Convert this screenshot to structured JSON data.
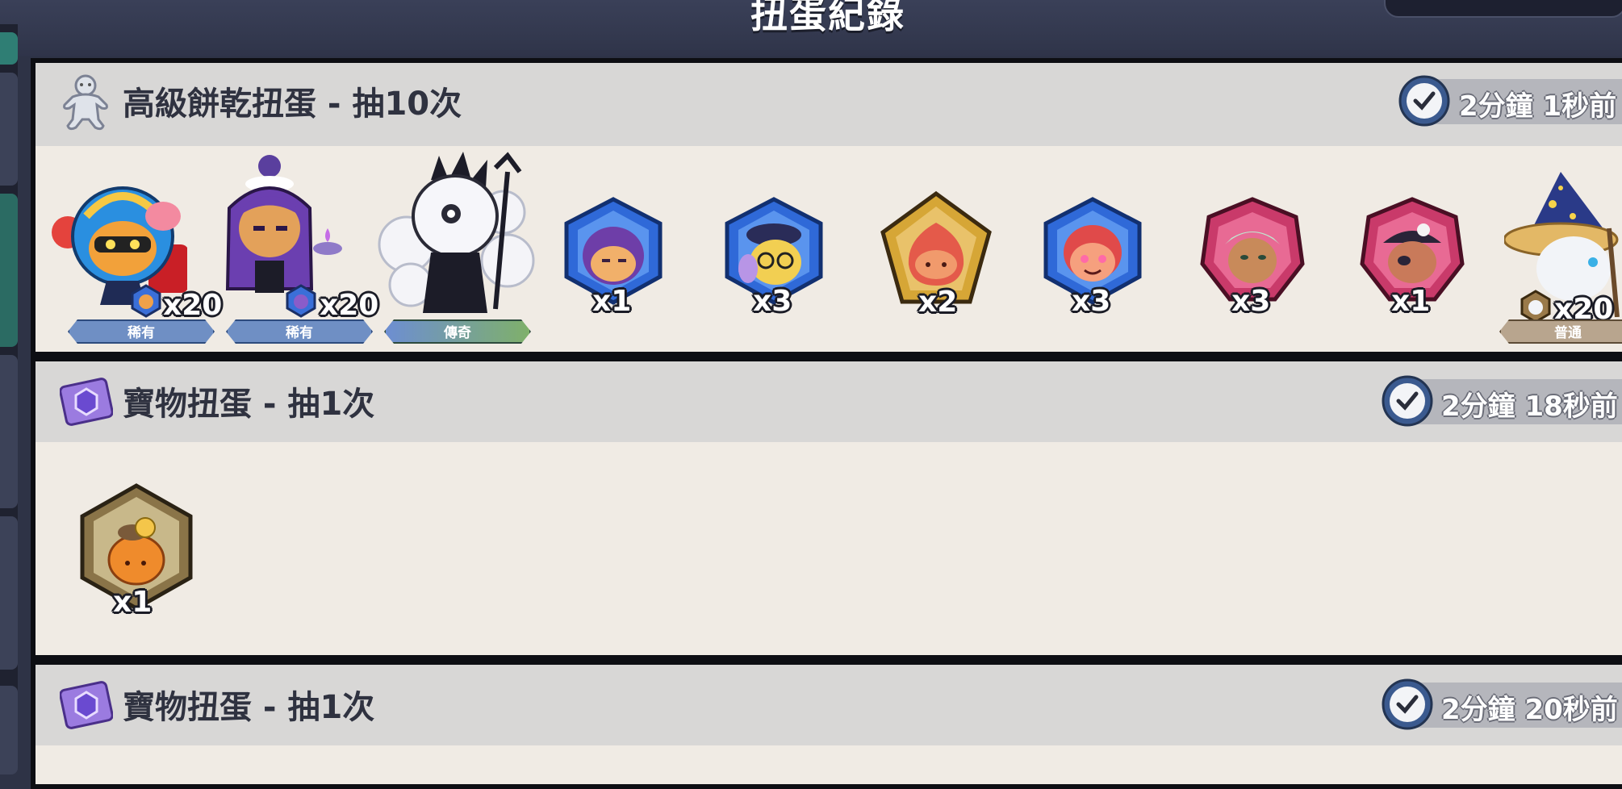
{
  "header": {
    "title": "扭蛋紀錄"
  },
  "records": [
    {
      "title": "高級餅乾扭蛋 - 抽10次",
      "time": "2分鐘 1秒前",
      "icon": "gingerbread-cookie-icon",
      "items": [
        {
          "name": "racer-cookie-card",
          "qty": "x20",
          "rarity": "稀有"
        },
        {
          "name": "purple-maid-cookie-card",
          "qty": "x20",
          "rarity": "稀有"
        },
        {
          "name": "white-demon-cookie-card",
          "qty": "",
          "rarity": "傳奇"
        },
        {
          "name": "purple-hair-soulstone",
          "qty": "x1",
          "rarity": ""
        },
        {
          "name": "detective-cookie-soulstone",
          "qty": "x3",
          "rarity": ""
        },
        {
          "name": "red-gold-soulstone",
          "qty": "x2",
          "rarity": ""
        },
        {
          "name": "pink-cheek-soulstone",
          "qty": "x3",
          "rarity": ""
        },
        {
          "name": "mint-cookie-soulstone",
          "qty": "x3",
          "rarity": ""
        },
        {
          "name": "pirate-cookie-soulstone",
          "qty": "x1",
          "rarity": ""
        },
        {
          "name": "wizard-cookie-card",
          "qty": "x20",
          "rarity": "普通"
        }
      ]
    },
    {
      "title": "寶物扭蛋 - 抽1次",
      "time": "2分鐘 18秒前",
      "icon": "treasure-ticket-icon",
      "items": [
        {
          "name": "treasure-pouch",
          "qty": "x1",
          "rarity": ""
        }
      ]
    },
    {
      "title": "寶物扭蛋 - 抽1次",
      "time": "2分鐘 20秒前",
      "icon": "treasure-ticket-icon",
      "items": []
    }
  ],
  "colors": {
    "rare": "#6f8fc4",
    "legendary": "#7fb06a",
    "common": "#b8a58e"
  }
}
